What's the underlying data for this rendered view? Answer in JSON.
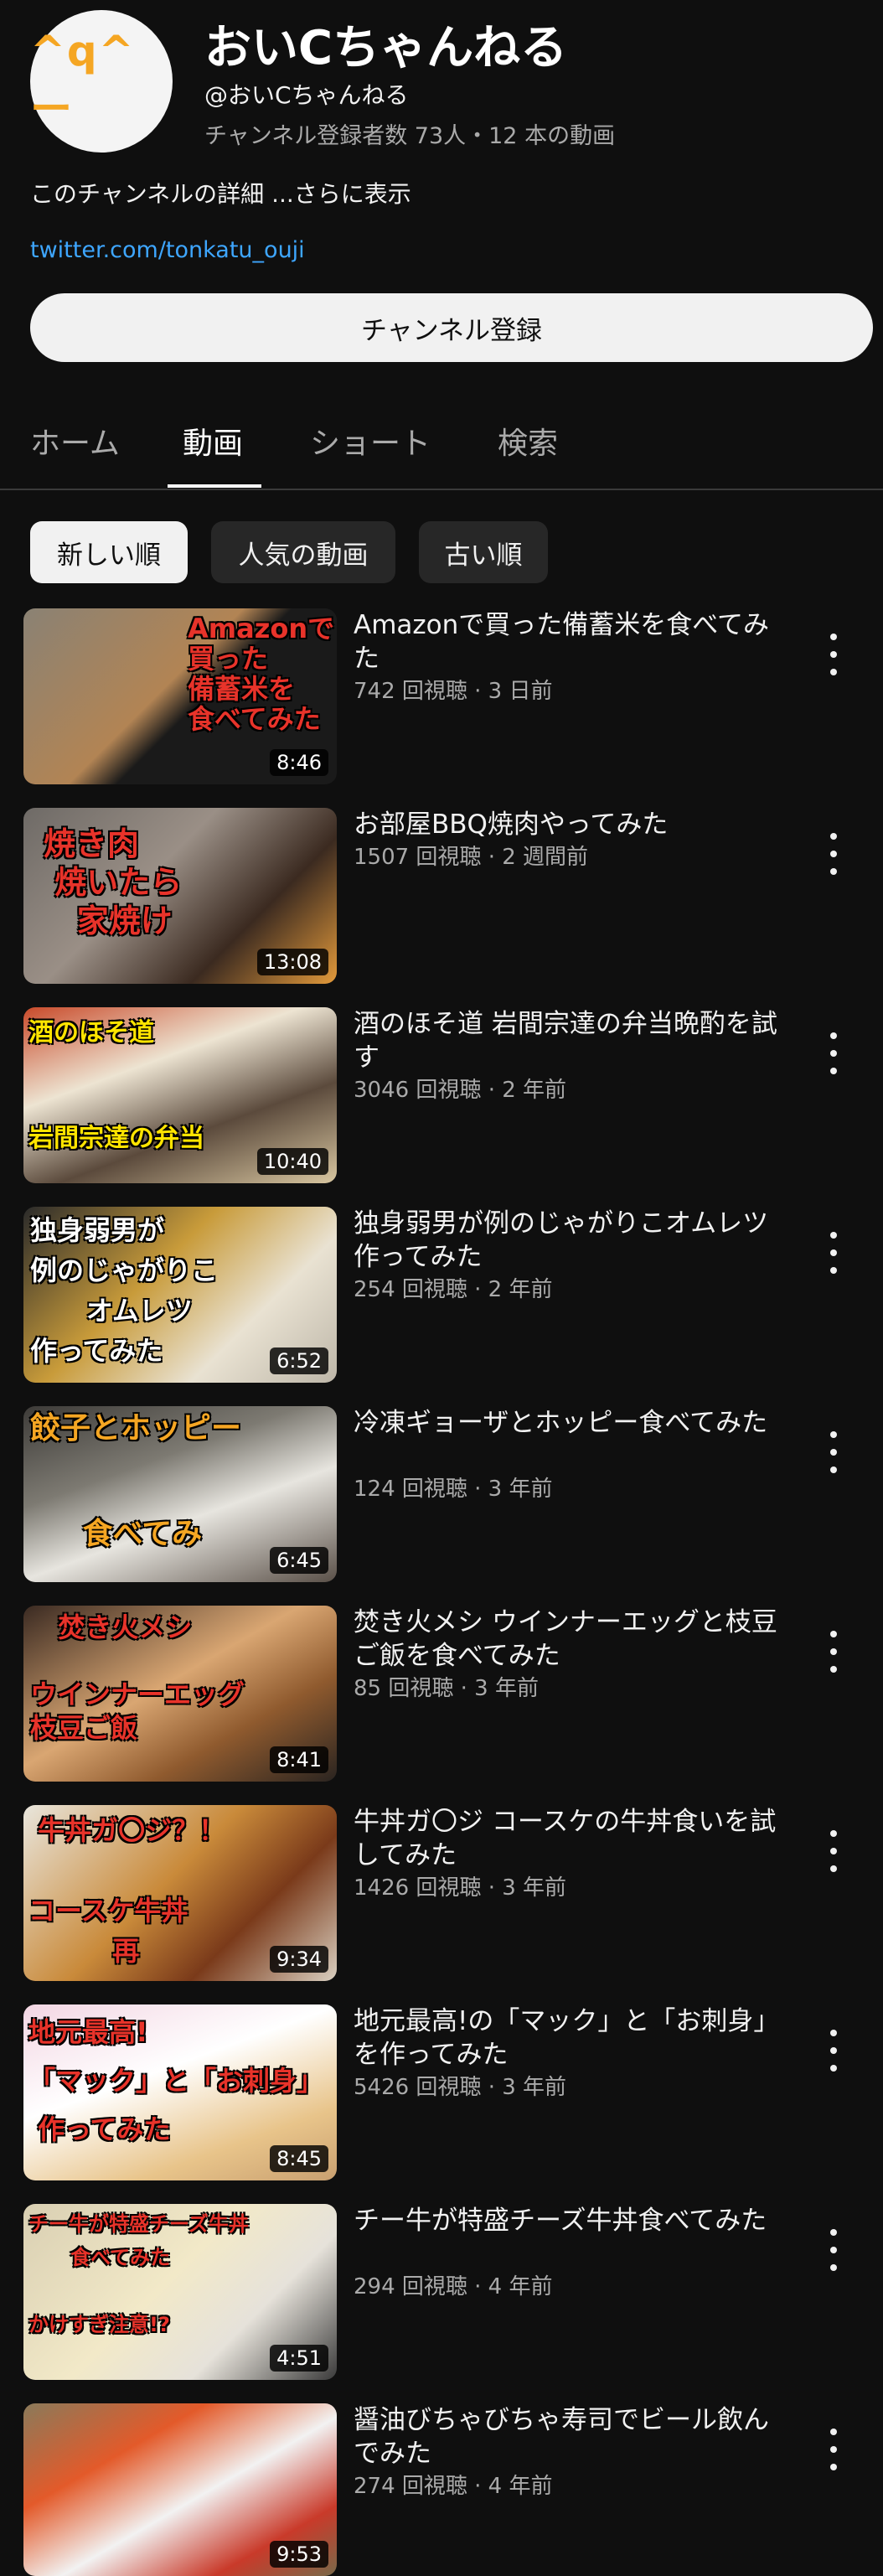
{
  "channel": {
    "avatar_text": "^q^ー",
    "name": "おいCちゃんねる",
    "handle": "@おいCちゃんねる",
    "stats": "チャンネル登録者数 73人・12 本の動画",
    "description": "このチャンネルの詳細",
    "more_label": "...さらに表示",
    "link": "twitter.com/tonkatu_ouji",
    "subscribe_label": "チャンネル登録"
  },
  "tabs": [
    {
      "label": "ホーム"
    },
    {
      "label": "動画"
    },
    {
      "label": "ショート"
    },
    {
      "label": "検索"
    }
  ],
  "active_tab": "動画",
  "filters": [
    {
      "label": "新しい順"
    },
    {
      "label": "人気の動画"
    },
    {
      "label": "古い順"
    }
  ],
  "active_filter": "新しい順",
  "videos": [
    {
      "title": "Amazonで買った備蓄米を食べてみた",
      "meta": "742 回視聴 · 3 日前",
      "duration": "8:46",
      "thumb_text": "Amazonで\n買った\n備蓄米を\n食べてみた"
    },
    {
      "title": "お部屋BBQ焼肉やってみた",
      "meta": "1507 回視聴 · 2 週間前",
      "duration": "13:08",
      "thumb_text": "焼き肉\n 焼いたら\n   家焼け"
    },
    {
      "title": "酒のほそ道 岩間宗達の弁当晩酌を試す",
      "meta": "3046 回視聴 · 2 年前",
      "duration": "10:40",
      "thumb_text": "酒のほそ道\n\n\n岩間宗達の弁当"
    },
    {
      "title": "独身弱男が例のじゃがりこオムレツ作ってみた",
      "meta": "254 回視聴 · 2 年前",
      "duration": "6:52",
      "thumb_text": "独身弱男が\n例のじゃがりこ\n      オムレツ\n作ってみた"
    },
    {
      "title": "冷凍ギョーザとホッピー食べてみた",
      "meta": "124 回視聴 · 3 年前",
      "duration": "6:45",
      "thumb_text": "餃子とホッピー\n\n\n     食べてみ"
    },
    {
      "title": "焚き火メシ ウインナーエッグと枝豆ご飯を食べてみた",
      "meta": "85 回視聴 · 3 年前",
      "duration": "8:41",
      "thumb_text": "   焚き火メシ\n\nウインナーエッグ\n枝豆ご飯"
    },
    {
      "title": "牛丼ガ〇ジ コースケの牛丼食いを試してみた",
      "meta": "1426 回視聴 · 3 年前",
      "duration": "9:34",
      "thumb_text": " 牛丼ガ〇ジ？！\n\nコースケ牛丼\n         再"
    },
    {
      "title": "地元最高!の「マック」と「お刺身」を作ってみた",
      "meta": "5426 回視聴 · 3 年前",
      "duration": "8:45",
      "thumb_text": "地元最高!\n「マック」と「お刺身」\n 作ってみた"
    },
    {
      "title": "チー牛が特盛チーズ牛丼食べてみた",
      "meta": "294 回視聴 · 4 年前",
      "duration": "4:51",
      "thumb_text": "チー牛が特盛チーズ牛丼\n      食べてみた\n\nかけすぎ注意!?"
    },
    {
      "title": "醤油びちゃびちゃ寿司でビール飲んでみた",
      "meta": "274 回視聴 · 4 年前",
      "duration": "9:53",
      "thumb_text": ""
    }
  ],
  "colors": {
    "background": "#0f0f0f",
    "link": "#3ea6ff",
    "secondary_text": "#aaaaaa",
    "avatar_accent": "#f5a623"
  }
}
